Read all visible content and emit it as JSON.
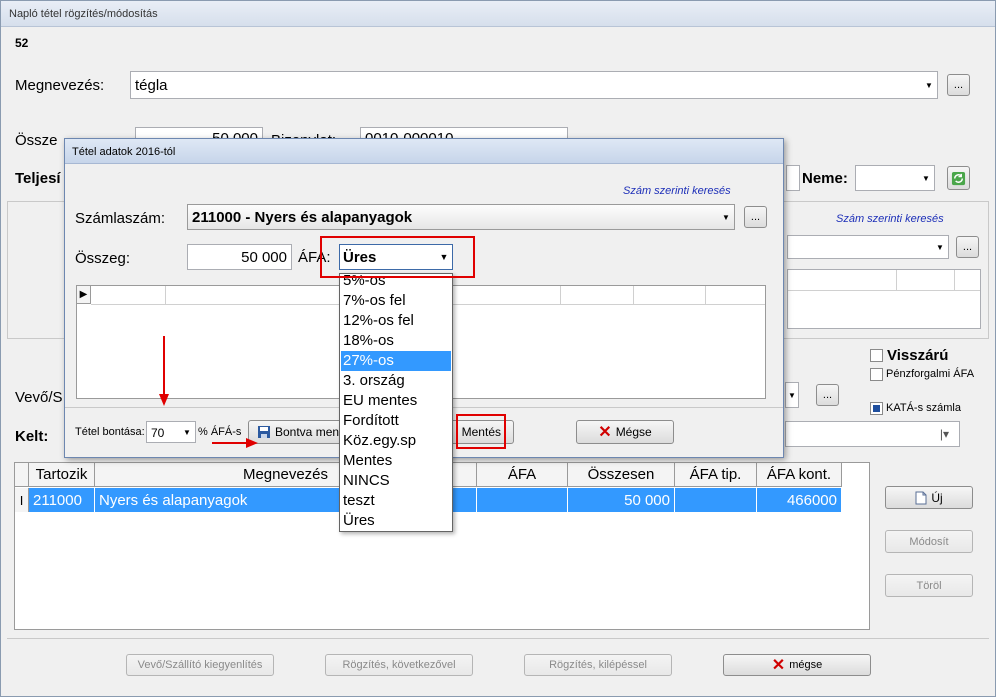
{
  "window": {
    "title": "Napló tétel rögzítés/módosítás",
    "record_no": "52"
  },
  "main": {
    "megnevezes_label": "Megnevezés:",
    "megnevezes_value": "tégla",
    "osszeg_label_partial": "Össze",
    "osszeg_value_partial": "50 000",
    "bizonylat_label_partial": "Bizonylat:",
    "bizonylat_value_partial": "0010-000010",
    "teljesites_label_partial": "Teljesí",
    "neme_label": "Neme:",
    "szam_kereses_link": "Szám szerinti keresés",
    "vevo_label_partial": "Vevő/S",
    "kelt_label": "Kelt:",
    "visszaru_label": "Visszárú",
    "penzforgalmi_label": "Pénzforgalmi ÁFA",
    "kata_label": "KATÁ-s számla",
    "ellipsis": "..."
  },
  "table": {
    "headers": [
      "Tartozik",
      "Megnevezés",
      "ÁFA",
      "Összesen",
      "ÁFA tip.",
      "ÁFA kont."
    ],
    "row": {
      "indicator": "I",
      "tartozik": "211000",
      "megnevezes": "Nyers és alapanyagok",
      "afa": "",
      "osszesen": "50 000",
      "afa_tip": "",
      "afa_kont": "466000"
    }
  },
  "side_buttons": {
    "uj": "Új",
    "modosit": "Módosít",
    "torol": "Töröl"
  },
  "bottom_buttons": {
    "kiegyenlites": "Vevő/Szállító kiegyenlítés",
    "rogzites_kovetkezovel": "Rögzítés, következővel",
    "rogzites_kilepessel": "Rögzítés, kilépéssel",
    "megse": "mégse"
  },
  "dialog": {
    "title": "Tétel adatok 2016-tól",
    "szam_kereses_link": "Szám szerinti keresés",
    "szamlaszam_label": "Számlaszám:",
    "szamlaszam_value": "211000 - Nyers és alapanyagok",
    "osszeg_label": "Összeg:",
    "osszeg_value": "50 000",
    "afa_label": "ÁFA:",
    "afa_value": "Üres",
    "tetel_bontasa_label": "Tétel bontása:",
    "tetel_bontasa_value": "70",
    "afas_label": "% ÁFÁ-s",
    "bontva_mentes": "Bontva ment",
    "mentes": "Mentés",
    "megse": "Mégse",
    "ellipsis": "..."
  },
  "afa_options": [
    "5%-os",
    "7%-os fel",
    "12%-os fel",
    "18%-os",
    "27%-os",
    "3. ország",
    "EU mentes",
    "Fordított",
    "Köz.egy.sp",
    "Mentes",
    "NINCS",
    "teszt",
    "Üres"
  ],
  "afa_selected_index": 4,
  "colors": {
    "selection": "#3399ff",
    "annotation_red": "#e00000",
    "link_blue": "#1d2fb8"
  }
}
